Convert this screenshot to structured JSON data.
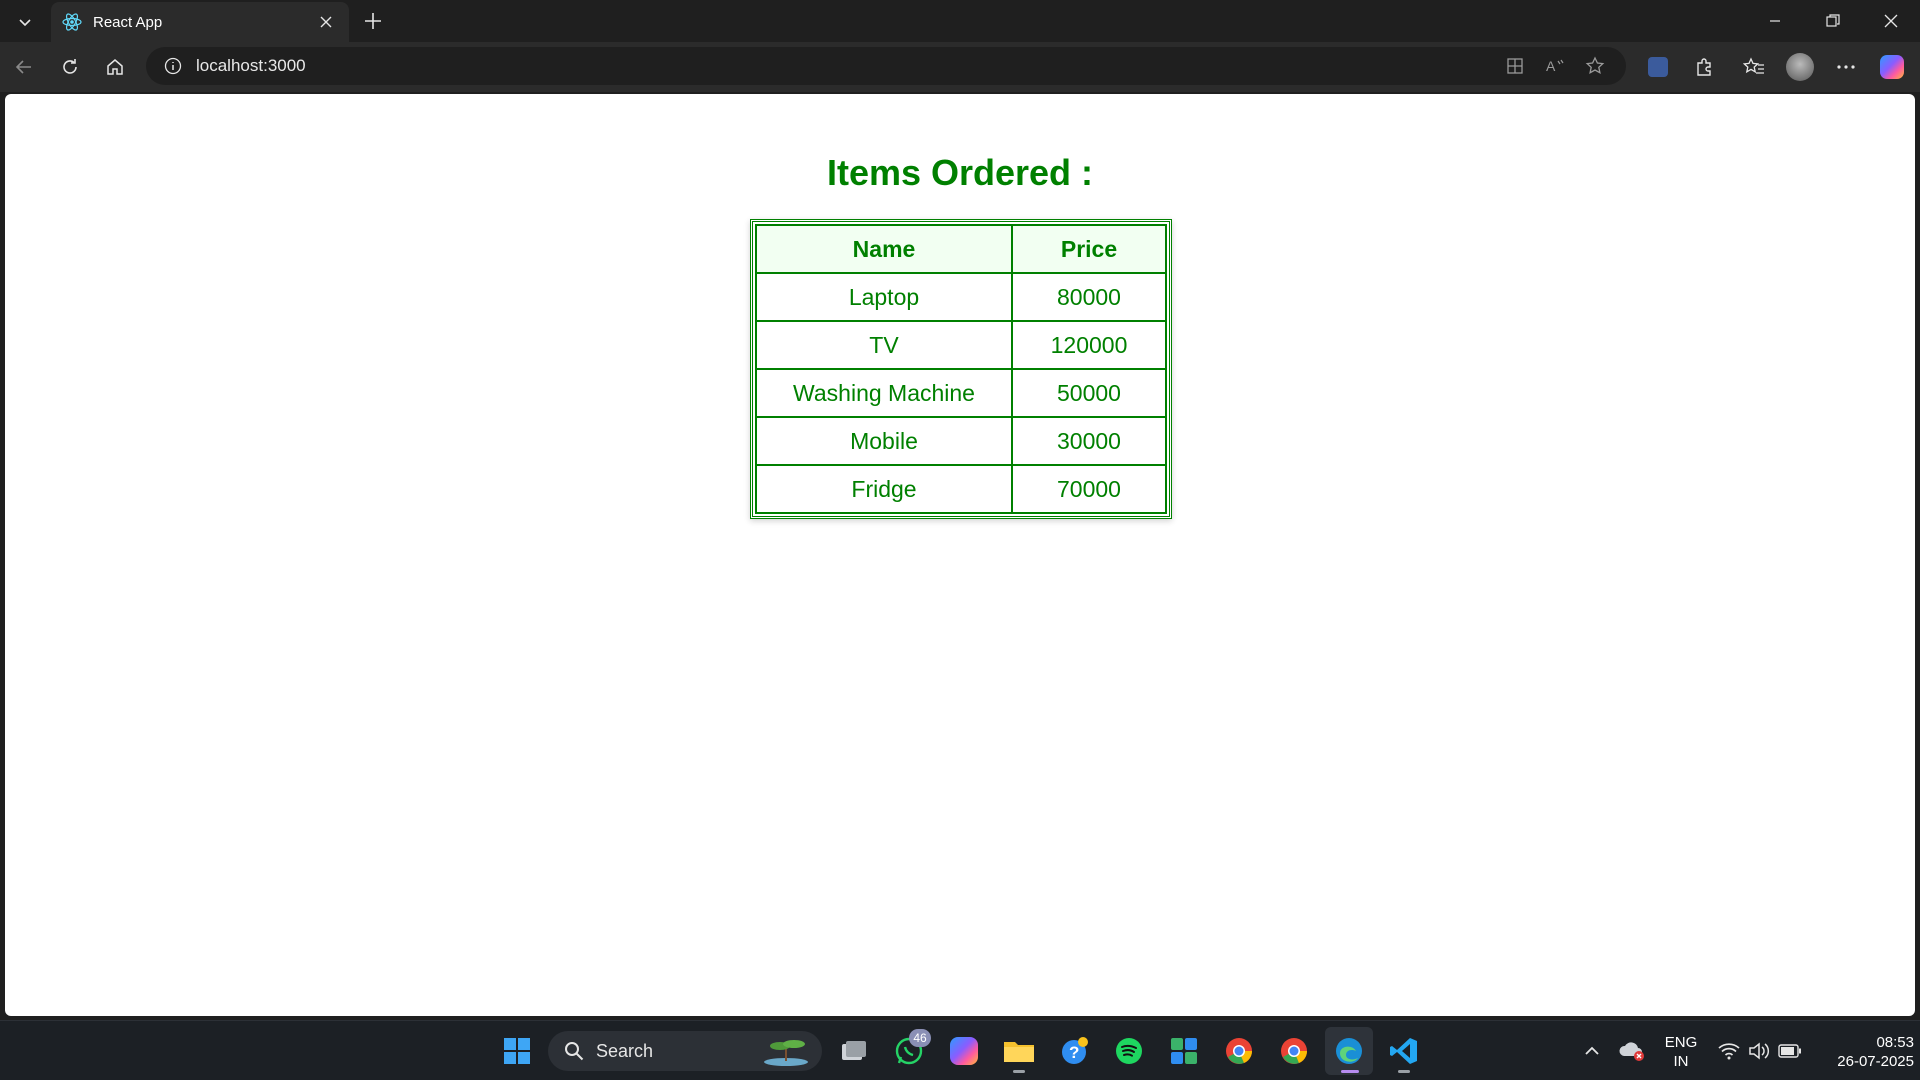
{
  "browser": {
    "tab_title": "React App",
    "url": "localhost:3000"
  },
  "page": {
    "heading": "Items Ordered :",
    "table": {
      "headers": [
        "Name",
        "Price"
      ],
      "rows": [
        [
          "Laptop",
          "80000"
        ],
        [
          "TV",
          "120000"
        ],
        [
          "Washing Machine",
          "50000"
        ],
        [
          "Mobile",
          "30000"
        ],
        [
          "Fridge",
          "70000"
        ]
      ]
    },
    "colors": {
      "accent": "#008000"
    }
  },
  "taskbar": {
    "search_placeholder": "Search",
    "whatsapp_badge": "46",
    "lang_line1": "ENG",
    "lang_line2": "IN",
    "time": "08:53",
    "date": "26-07-2025"
  }
}
